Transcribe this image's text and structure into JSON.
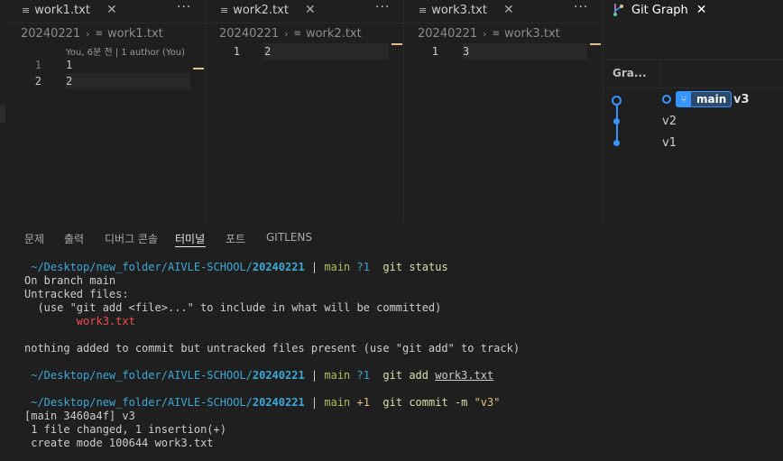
{
  "editors": [
    {
      "tab_label": "work1.txt",
      "crumb_folder": "20240221",
      "crumb_file": "work1.txt",
      "blame": "You, 6분 전 | 1 author (You)",
      "lines": [
        {
          "num": "1",
          "text": "1"
        },
        {
          "num": "2",
          "text": "2"
        }
      ]
    },
    {
      "tab_label": "work2.txt",
      "crumb_folder": "20240221",
      "crumb_file": "work2.txt",
      "lines": [
        {
          "num": "1",
          "text": "2"
        }
      ]
    },
    {
      "tab_label": "work3.txt",
      "crumb_folder": "20240221",
      "crumb_file": "work3.txt",
      "lines": [
        {
          "num": "1",
          "text": "3"
        }
      ]
    }
  ],
  "git_graph": {
    "tab_label": "Git Graph",
    "column_header": "Gra...",
    "branch": "main",
    "commits": [
      "v3",
      "v2",
      "v1"
    ]
  },
  "panel": {
    "tabs": [
      "문제",
      "출력",
      "디버그 콘솔",
      "터미널",
      "포트",
      "GITLENS"
    ],
    "active_tab": "터미널"
  },
  "terminal": {
    "path": "~/Desktop/new_folder/AIVLE-SCHOOL/",
    "dir": "20240221",
    "bar": "|",
    "branch": "main",
    "untracked": "?1",
    "ahead": "+1",
    "cmd1": "git status",
    "out1_1": "On branch main",
    "out1_2": "Untracked files:",
    "out1_3": "  (use \"git add <file>...\" to include in what will be committed)",
    "out1_4": "        work3.txt",
    "out1_5": "nothing added to commit but untracked files present (use \"git add\" to track)",
    "cmd2": "git add",
    "cmd2_arg": "work3.txt",
    "cmd3": "git commit -m",
    "cmd3_arg": "\"v3\"",
    "out3_1": "[main 3460a4f] v3",
    "out3_2": " 1 file changed, 1 insertion(+)",
    "out3_3": " create mode 100644 work3.txt"
  }
}
